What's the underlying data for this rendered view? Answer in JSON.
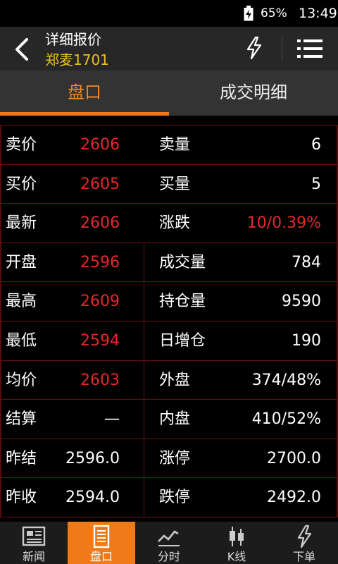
{
  "status": {
    "battery": "65%",
    "time": "13:49"
  },
  "header": {
    "title": "详细报价",
    "subtitle": "郑麦1701"
  },
  "tabs": [
    {
      "label": "盘口"
    },
    {
      "label": "成交明细"
    }
  ],
  "rows": [
    {
      "label1": "卖价",
      "value1": "2606",
      "label2": "卖量",
      "value2": "6"
    },
    {
      "label1": "买价",
      "value1": "2605",
      "label2": "买量",
      "value2": "5"
    },
    {
      "label1": "最新",
      "value1": "2606",
      "label2": "涨跌",
      "value2": "10/0.39%"
    },
    {
      "label1": "开盘",
      "value1": "2596",
      "label2": "成交量",
      "value2": "784"
    },
    {
      "label1": "最高",
      "value1": "2609",
      "label2": "持仓量",
      "value2": "9590"
    },
    {
      "label1": "最低",
      "value1": "2594",
      "label2": "日增仓",
      "value2": "190"
    },
    {
      "label1": "均价",
      "value1": "2603",
      "label2": "外盘",
      "value2": "374/48%"
    },
    {
      "label1": "结算",
      "value1": "—",
      "label2": "内盘",
      "value2": "410/52%"
    },
    {
      "label1": "昨结",
      "value1": "2596.0",
      "label2": "涨停",
      "value2": "2700.0"
    },
    {
      "label1": "昨收",
      "value1": "2594.0",
      "label2": "跌停",
      "value2": "2492.0"
    }
  ],
  "nav": [
    {
      "label": "新闻",
      "icon": "newspaper-icon"
    },
    {
      "label": "盘口",
      "icon": "quote-sheet-icon"
    },
    {
      "label": "分时",
      "icon": "trend-line-icon"
    },
    {
      "label": "K线",
      "icon": "candlestick-icon"
    },
    {
      "label": "下单",
      "icon": "lightning-icon"
    }
  ],
  "colors": {
    "accent": "#f07a18",
    "price_red": "#e62828",
    "subtitle_yellow": "#e8c020",
    "grid_red": "#6a0f0f"
  }
}
